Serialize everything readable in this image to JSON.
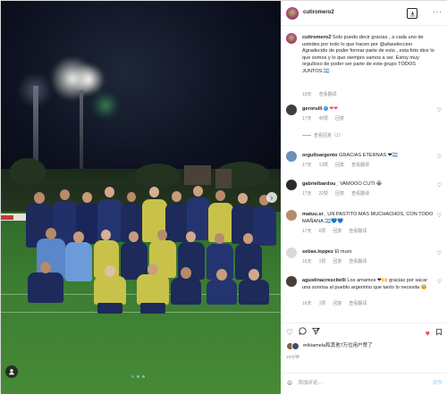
{
  "post": {
    "username": "cutiromero2",
    "caption_user": "cutiromero2",
    "caption": "Solo puedo decir gracias , a cada uno de ustedes por todo lo que hacen por @afaseleccion Agradecido de poder formar parte de esto , esta foto dice lo que somos y lo que siempre vamos a ser. Estoy muy orgulloso de poder ser parte de este grupo TODOS JUNTOS 🇦🇷",
    "caption_time": "19天",
    "caption_reply": "查看翻译",
    "more_label": "···"
  },
  "comments": [
    {
      "user": "geroruili",
      "verified": true,
      "text": "❤❤",
      "time": "17天",
      "likes": "45赞",
      "reply": "回复",
      "view_replies": "查看回复（1）"
    },
    {
      "user": "orgulloargento",
      "verified": false,
      "text": "GRACIAS ETERNAS ❤🇦🇷",
      "time": "17天",
      "likes": "13赞",
      "reply": "回复",
      "translate": "查看翻译"
    },
    {
      "user": "gabrielbardou_",
      "verified": false,
      "text": "VAMOOO CUTI 😭",
      "time": "17天",
      "likes": "22赞",
      "reply": "回复",
      "translate": "查看翻译"
    },
    {
      "user": "matuu.sr_",
      "verified": false,
      "text": "UN PASTITO MAS MUCHACHOS, CON TODO MAÑANA 🇦🇷💙💙",
      "time": "17天",
      "likes": "6赞",
      "reply": "回复",
      "translate": "查看翻译"
    },
    {
      "user": "sebas.leppez",
      "verified": false,
      "text": "El muro",
      "time": "16天",
      "likes": "1赞",
      "reply": "回复",
      "translate": "查看翻译"
    },
    {
      "user": "agustinacrescitelli",
      "verified": false,
      "text": "Los amamos ❤🙌 gracias por sacar una sonrisa al pueblo argentino que tanto lo necesita 🥹",
      "time": "16天",
      "likes": "1赞",
      "reply": "回复",
      "translate": "查看翻译"
    }
  ],
  "footer": {
    "likes_text": "erikiamela和其他7万位用户赞了",
    "time": "19分钟",
    "add_comment": "添加评论...",
    "post_label": "发布"
  },
  "colors": {
    "accent": "#3897f0",
    "story_ring": "#d6249f",
    "like_red": "#ed4956"
  }
}
